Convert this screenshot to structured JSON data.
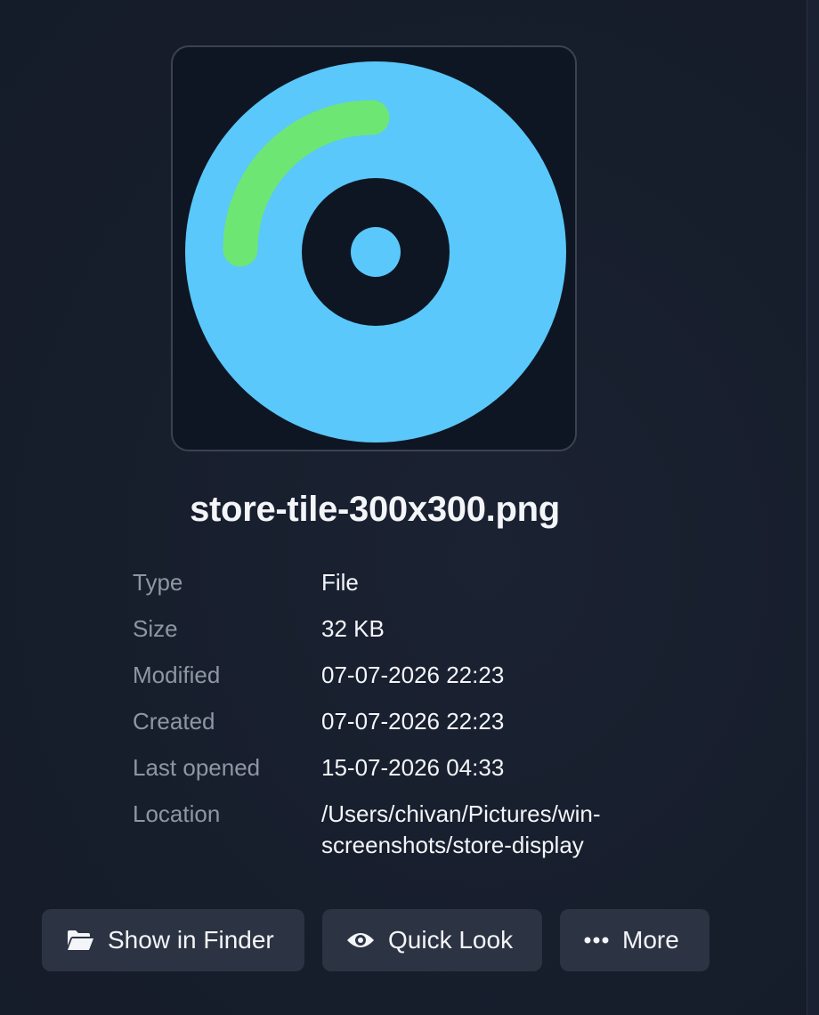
{
  "file": {
    "name": "store-tile-300x300.png",
    "preview_icon": "disc-icon",
    "preview_colors": {
      "background": "#0f1623",
      "disc": "#5ac8fa",
      "accent": "#6ee673",
      "hole": "#0f1623"
    }
  },
  "info": [
    {
      "label": "Type",
      "value": "File"
    },
    {
      "label": "Size",
      "value": "32 KB"
    },
    {
      "label": "Modified",
      "value": "07-07-2026 22:23"
    },
    {
      "label": "Created",
      "value": "07-07-2026 22:23"
    },
    {
      "label": "Last opened",
      "value": "15-07-2026 04:33"
    },
    {
      "label": "Location",
      "value": "/Users/chivan/Pictures/win-screenshots/store-display"
    }
  ],
  "actions": {
    "show_in_finder": {
      "label": "Show in Finder",
      "icon": "folder-open-icon"
    },
    "quick_look": {
      "label": "Quick Look",
      "icon": "eye-icon"
    },
    "more": {
      "label": "More",
      "icon": "ellipsis-icon"
    }
  }
}
